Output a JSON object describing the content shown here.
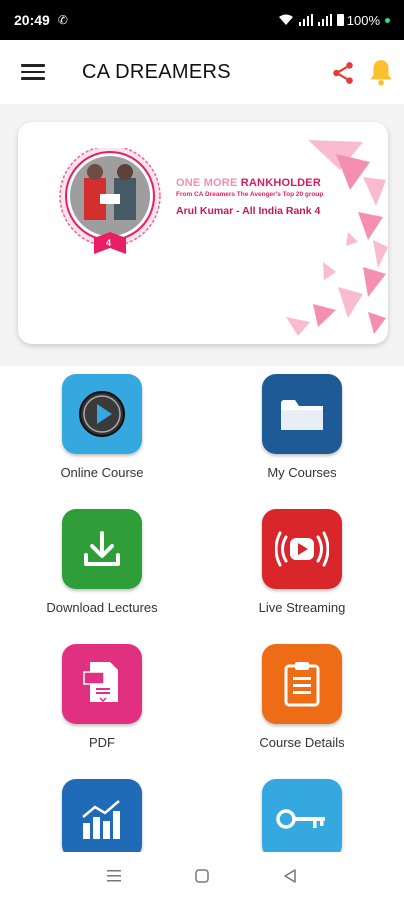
{
  "status_bar": {
    "time": "20:49",
    "battery": "100%"
  },
  "app_bar": {
    "title": "CA DREAMERS"
  },
  "banner": {
    "headline_light": "ONE MORE",
    "headline_bold": " RANKHOLDER",
    "subtext": "From CA Dreamers The Avenger's Top 20 group",
    "name": "Arul Kumar - All India Rank 4",
    "badge_number": "4"
  },
  "menu": [
    {
      "label": "Online Course",
      "icon": "play-circle-icon",
      "color": "#35a8e0"
    },
    {
      "label": "My Courses",
      "icon": "folder-icon",
      "color": "#1e5b96"
    },
    {
      "label": "Download Lectures",
      "icon": "download-icon",
      "color": "#2f9e38"
    },
    {
      "label": "Live Streaming",
      "icon": "live-stream-icon",
      "color": "#d8262a"
    },
    {
      "label": "PDF",
      "icon": "pdf-icon",
      "color": "#e0307f"
    },
    {
      "label": "Course Details",
      "icon": "clipboard-icon",
      "color": "#ef6c16"
    },
    {
      "label": "",
      "icon": "analytics-chart-icon",
      "color": "#1f6bb8"
    },
    {
      "label": "",
      "icon": "key-icon",
      "color": "#35a8e0"
    }
  ],
  "colors": {
    "share": "#e53935",
    "bell": "#fbc02d",
    "brand_pink": "#e91e63"
  }
}
